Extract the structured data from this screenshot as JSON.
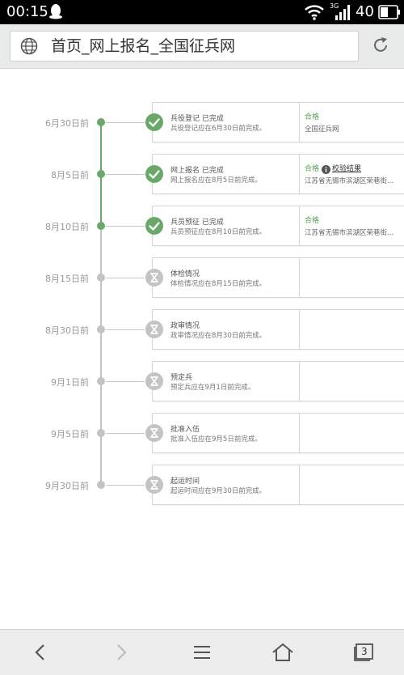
{
  "statusbar": {
    "time": "00:15",
    "network": "3G",
    "battery": "40"
  },
  "url_bar": {
    "title": "首页_网上报名_全国征兵网"
  },
  "timeline": [
    {
      "date": "6月30日前",
      "title": "兵役登记 已完成",
      "sub": "兵役登记应在6月30日前完成。",
      "status": "done",
      "result": "合格",
      "detail": "全国征兵网",
      "link": ""
    },
    {
      "date": "8月5日前",
      "title": "网上报名 已完成",
      "sub": "网上报名应在8月5日前完成。",
      "status": "done",
      "result": "合格",
      "detail": "江苏省无锡市滨湖区荣巷街...",
      "link": "校验结果"
    },
    {
      "date": "8月10日前",
      "title": "兵员预征 已完成",
      "sub": "兵员预征应在8月10日前完成。",
      "status": "done",
      "result": "合格",
      "detail": "江苏省无锡市滨湖区荣巷街...",
      "link": ""
    },
    {
      "date": "8月15日前",
      "title": "体检情况",
      "sub": "体检情况应在8月15日前完成。",
      "status": "pending",
      "result": "",
      "detail": "",
      "link": ""
    },
    {
      "date": "8月30日前",
      "title": "政审情况",
      "sub": "政审情况应在8月30日前完成。",
      "status": "pending",
      "result": "",
      "detail": "",
      "link": ""
    },
    {
      "date": "9月1日前",
      "title": "预定兵",
      "sub": "预定兵应在9月1日前完成。",
      "status": "pending",
      "result": "",
      "detail": "",
      "link": ""
    },
    {
      "date": "9月5日前",
      "title": "批准入伍",
      "sub": "批准入伍应在9月5日前完成。",
      "status": "pending",
      "result": "",
      "detail": "",
      "link": ""
    },
    {
      "date": "9月30日前",
      "title": "起运时间",
      "sub": "起运时间应在9月30日前完成。",
      "status": "pending",
      "result": "",
      "detail": "",
      "link": ""
    }
  ],
  "bottom_nav": {
    "tab_count": "3"
  },
  "colors": {
    "done_green": "#6aa86a",
    "pending_gray": "#c4c4c4"
  }
}
